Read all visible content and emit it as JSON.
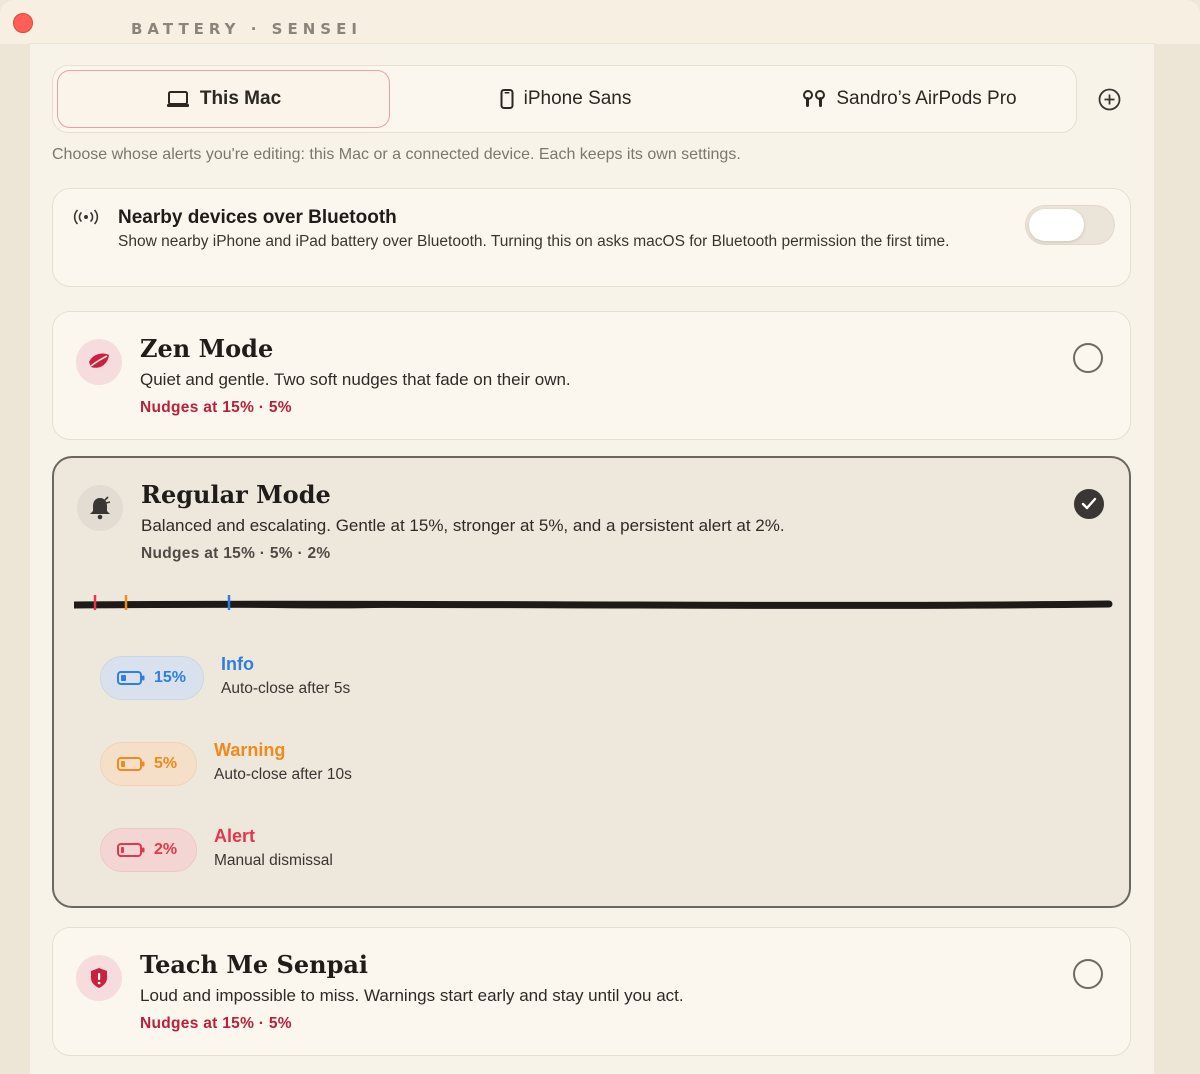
{
  "app": {
    "title": "BATTERY · SENSEI"
  },
  "tabs": [
    {
      "label": "This Mac",
      "icon": "laptop-icon",
      "active": true
    },
    {
      "label": "iPhone Sans",
      "icon": "iphone-icon",
      "active": false
    },
    {
      "label": "Sandro’s AirPods Pro",
      "icon": "airpods-icon",
      "active": false
    }
  ],
  "hint": "Choose whose alerts you're editing: this Mac or a connected device. Each keeps its own settings.",
  "bluetooth": {
    "title": "Nearby devices over Bluetooth",
    "description": "Show nearby iPhone and iPad battery over Bluetooth. Turning this on asks macOS for Bluetooth permission the first time.",
    "enabled": false
  },
  "modes": {
    "zen": {
      "title": "Zen Mode",
      "description": "Quiet and gentle. Two soft nudges that fade on their own.",
      "nudges": "Nudges at 15% · 5%",
      "selected": false
    },
    "regular": {
      "title": "Regular Mode",
      "description": "Balanced and escalating. Gentle at 15%, stronger at 5%, and a persistent alert at 2%.",
      "nudges": "Nudges at 15% · 5% · 2%",
      "selected": true,
      "levels": [
        {
          "percent": "15%",
          "name": "Info",
          "detail": "Auto-close after 5s",
          "color": "#2f7fe0"
        },
        {
          "percent": "5%",
          "name": "Warning",
          "detail": "Auto-close after 10s",
          "color": "#f08a1c"
        },
        {
          "percent": "2%",
          "name": "Alert",
          "detail": "Manual dismissal",
          "color": "#e5364a"
        }
      ]
    },
    "teach": {
      "title": "Teach Me Senpai",
      "description": "Loud and impossible to miss. Warnings start early and stay until you act.",
      "nudges": "Nudges at 15% · 5%",
      "selected": false
    }
  },
  "colors": {
    "accent_red": "#b8213b",
    "info_blue": "#2f7fe0",
    "warning_orange": "#f08a1c",
    "alert_red": "#e5364a"
  }
}
